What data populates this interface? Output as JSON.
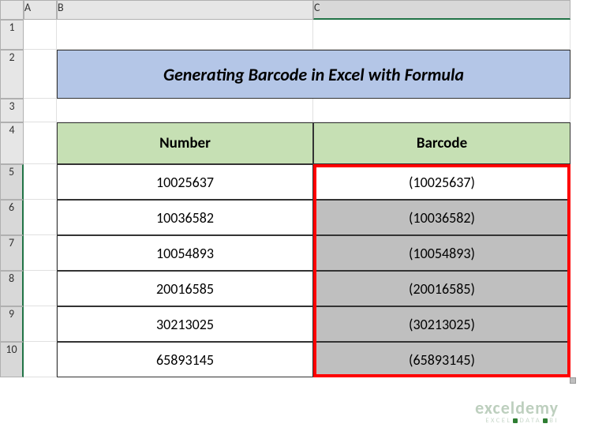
{
  "columns": [
    "A",
    "B",
    "C"
  ],
  "rows": [
    "1",
    "2",
    "3",
    "4",
    "5",
    "6",
    "7",
    "8",
    "9",
    "10"
  ],
  "title": "Generating Barcode in Excel with Formula",
  "headers": {
    "number": "Number",
    "barcode": "Barcode"
  },
  "data": [
    {
      "number": "10025637",
      "barcode": "(10025637)"
    },
    {
      "number": "10036582",
      "barcode": "(10036582)"
    },
    {
      "number": "10054893",
      "barcode": "(10054893)"
    },
    {
      "number": "20016585",
      "barcode": "(20016585)"
    },
    {
      "number": "30213025",
      "barcode": "(30213025)"
    },
    {
      "number": "65893145",
      "barcode": "(65893145)"
    }
  ],
  "watermark": {
    "brand": "exceldemy",
    "tagline": "EXCEL    DATA    BI"
  },
  "chart_data": {
    "type": "table",
    "title": "Generating Barcode in Excel with Formula",
    "columns": [
      "Number",
      "Barcode"
    ],
    "rows": [
      [
        "10025637",
        "(10025637)"
      ],
      [
        "10036582",
        "(10036582)"
      ],
      [
        "10054893",
        "(10054893)"
      ],
      [
        "20016585",
        "(20016585)"
      ],
      [
        "30213025",
        "(30213025)"
      ],
      [
        "65893145",
        "(65893145)"
      ]
    ]
  }
}
